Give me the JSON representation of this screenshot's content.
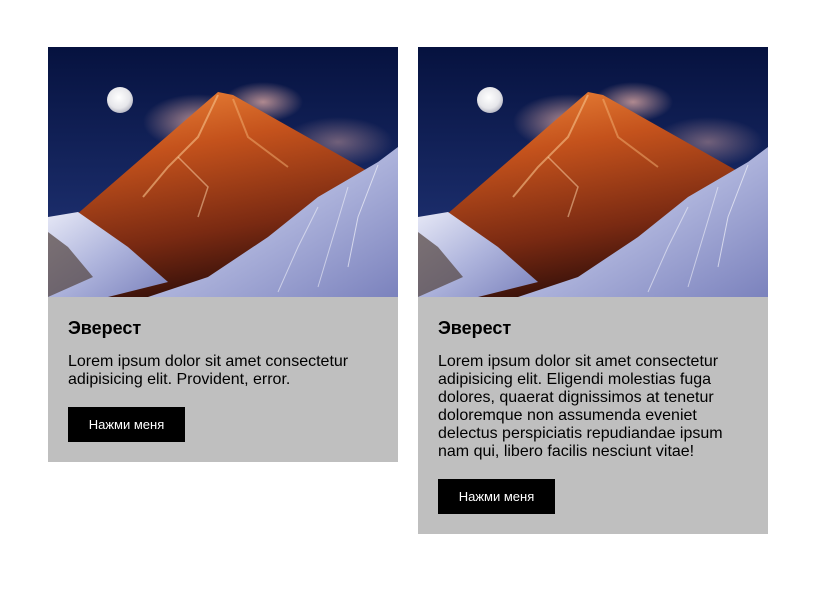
{
  "cards": [
    {
      "image_subject": "mountain-everest-photo",
      "title": "Эверест",
      "text": "Lorem ipsum dolor sit amet consectetur adipisicing elit. Provident, error.",
      "button_label": "Нажми меня"
    },
    {
      "image_subject": "mountain-everest-photo",
      "title": "Эверест",
      "text": "Lorem ipsum dolor sit amet consectetur adipisicing elit. Eligendi molestias fuga dolores, quaerat dignissimos at tenetur doloremque non assumenda eveniet delectus perspiciatis repudiandae ipsum nam qui, libero facilis nesciunt vitae!",
      "button_label": "Нажми меня"
    }
  ],
  "colors": {
    "card_background": "#bfbfbf",
    "button_background": "#000000",
    "button_text": "#ffffff",
    "sky": "#0d1a4d",
    "peak_glow": "#c4521c",
    "snow": "#c9cce6"
  }
}
